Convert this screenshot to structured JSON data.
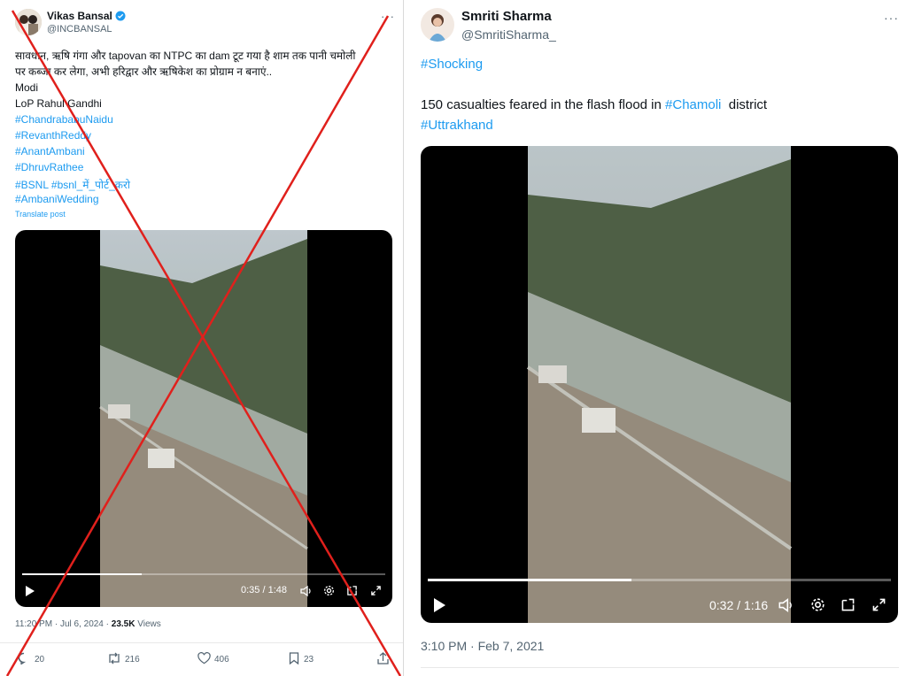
{
  "left": {
    "author": {
      "name": "Vikas Bansal",
      "handle": "@INCBANSAL",
      "verified_color": "#1d9bf0"
    },
    "more_label": "···",
    "text_lines": [
      "सावधान, ऋषि गंगा और tapovan का NTPC का dam टूट गया है शाम तक पानी चमोली",
      "पर कब्जा कर लेगा, अभी हरिद्वार और ऋषिकेश का प्रोग्राम न बनाएं..",
      "Modi",
      "LoP Rahul Gandhi"
    ],
    "hashtags": [
      "#ChandrababuNaidu",
      "#RevanthReddy",
      "#AnantAmbani",
      "#DhruvRathee",
      "#BSNL #bsnl_में_पोर्ट_करो",
      "#AmbaniWedding"
    ],
    "translate_label": "Translate post",
    "video": {
      "time": "0:35 / 1:48",
      "progress": 0.33
    },
    "meta": {
      "time_date": "11:20 PM · Jul 6, 2024 · ",
      "views_count": "23.5K",
      "views_label": " Views"
    },
    "actions": {
      "replies": "20",
      "reposts": "216",
      "likes": "406",
      "bookmarks": "23"
    },
    "cross_color": "#e0201c"
  },
  "right": {
    "author": {
      "name": "Smriti Sharma",
      "handle": "@SmritiSharma_"
    },
    "more_label": "···",
    "hashtag_line": "#Shocking",
    "body": {
      "before": "150 casualties feared in the flash flood in ",
      "tag": "#Chamoli",
      "after": "  district"
    },
    "hashtag_line2": "#Uttrakhand",
    "video": {
      "time": "0:32 / 1:16",
      "progress": 0.44
    },
    "timestamp": "3:10 PM · Feb 7, 2021"
  },
  "colors": {
    "link": "#1d9bf0",
    "muted": "#536471"
  }
}
